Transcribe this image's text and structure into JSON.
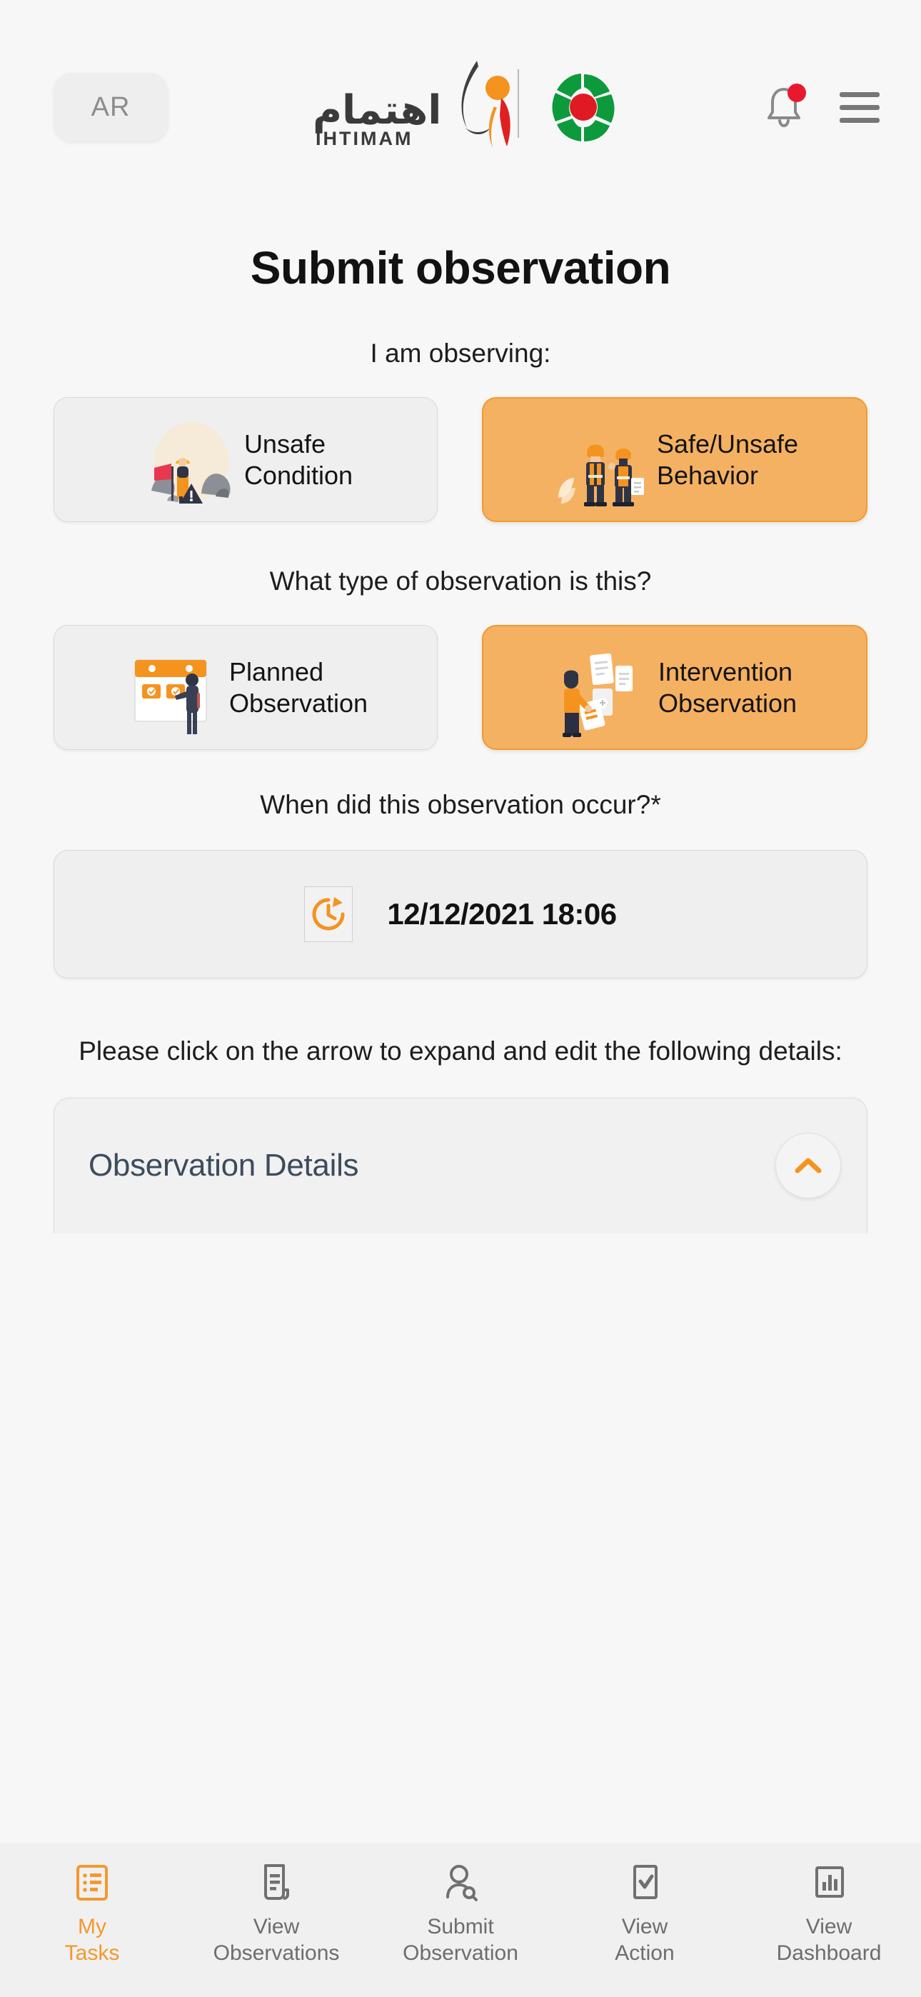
{
  "header": {
    "lang_button": "AR",
    "logo_arabic": "اهتمام",
    "logo_latin": "IHTIMAM",
    "bell_icon": "notification-bell-icon",
    "menu_icon": "hamburger-menu-icon",
    "brand_orange": "#F2992E",
    "brand_red": "#E8192C",
    "brand_green": "#0C9A3D"
  },
  "main": {
    "title": "Submit observation",
    "observing_label": "I am observing:",
    "observing_options": [
      {
        "label": "Unsafe\nCondition",
        "selected": false,
        "art": "unsafe-condition-illustration"
      },
      {
        "label": "Safe/Unsafe\nBehavior",
        "selected": true,
        "art": "safe-unsafe-behavior-illustration"
      }
    ],
    "type_label": "What type of observation is this?",
    "type_options": [
      {
        "label": "Planned\nObservation",
        "selected": false,
        "art": "planned-observation-illustration"
      },
      {
        "label": "Intervention\nObservation",
        "selected": true,
        "art": "intervention-observation-illustration"
      }
    ],
    "when_label": "When did this observation occur?*",
    "datetime_value": "12/12/2021 18:06",
    "datetime_icon": "clock-refresh-icon",
    "expand_note": "Please click on the arrow to expand and edit the following details:",
    "details_title": "Observation Details",
    "details_chevron": "chevron-up-icon"
  },
  "bottomnav": {
    "items": [
      {
        "label": "My\nTasks",
        "icon": "task-list-icon",
        "active": true
      },
      {
        "label": "View\nObservations",
        "icon": "document-icon",
        "active": false
      },
      {
        "label": "Submit\nObservation",
        "icon": "person-search-icon",
        "active": false
      },
      {
        "label": "View\nAction",
        "icon": "checkbox-check-icon",
        "active": false
      },
      {
        "label": "View\nDashboard",
        "icon": "bar-chart-icon",
        "active": false
      }
    ]
  }
}
